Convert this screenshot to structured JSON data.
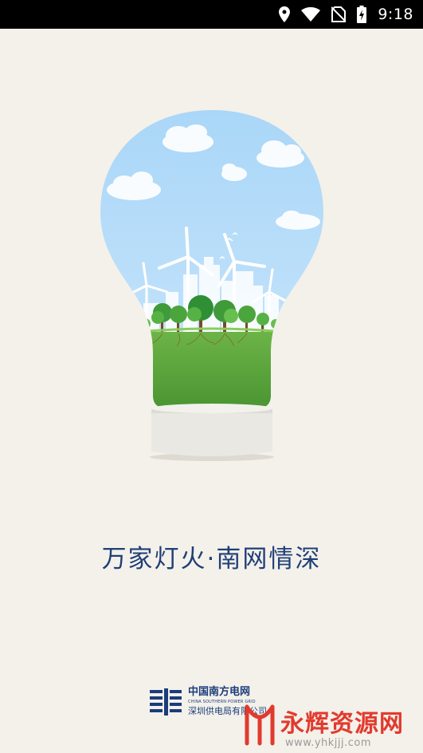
{
  "status_bar": {
    "time": "9:18",
    "icons": [
      "location-icon",
      "wifi-icon",
      "no-sim-icon",
      "battery-charging-icon"
    ]
  },
  "splash": {
    "slogan": "万家灯火·南网情深",
    "illustration": "lightbulb-wind-turbine-city-icon"
  },
  "footer": {
    "org_name_cn": "中国南方电网",
    "org_name_en": "CHINA SOUTHERN POWER GRID",
    "sub_org": "深圳供电局有限公司"
  },
  "watermark": {
    "title": "永辉资源网",
    "url": "www.yhkjjj.com"
  },
  "colors": {
    "background": "#f4f1ea",
    "slogan": "#1f3f78",
    "sky": "#a8d4f7",
    "grass": "#5aa838",
    "watermark": "#e23a2e"
  }
}
